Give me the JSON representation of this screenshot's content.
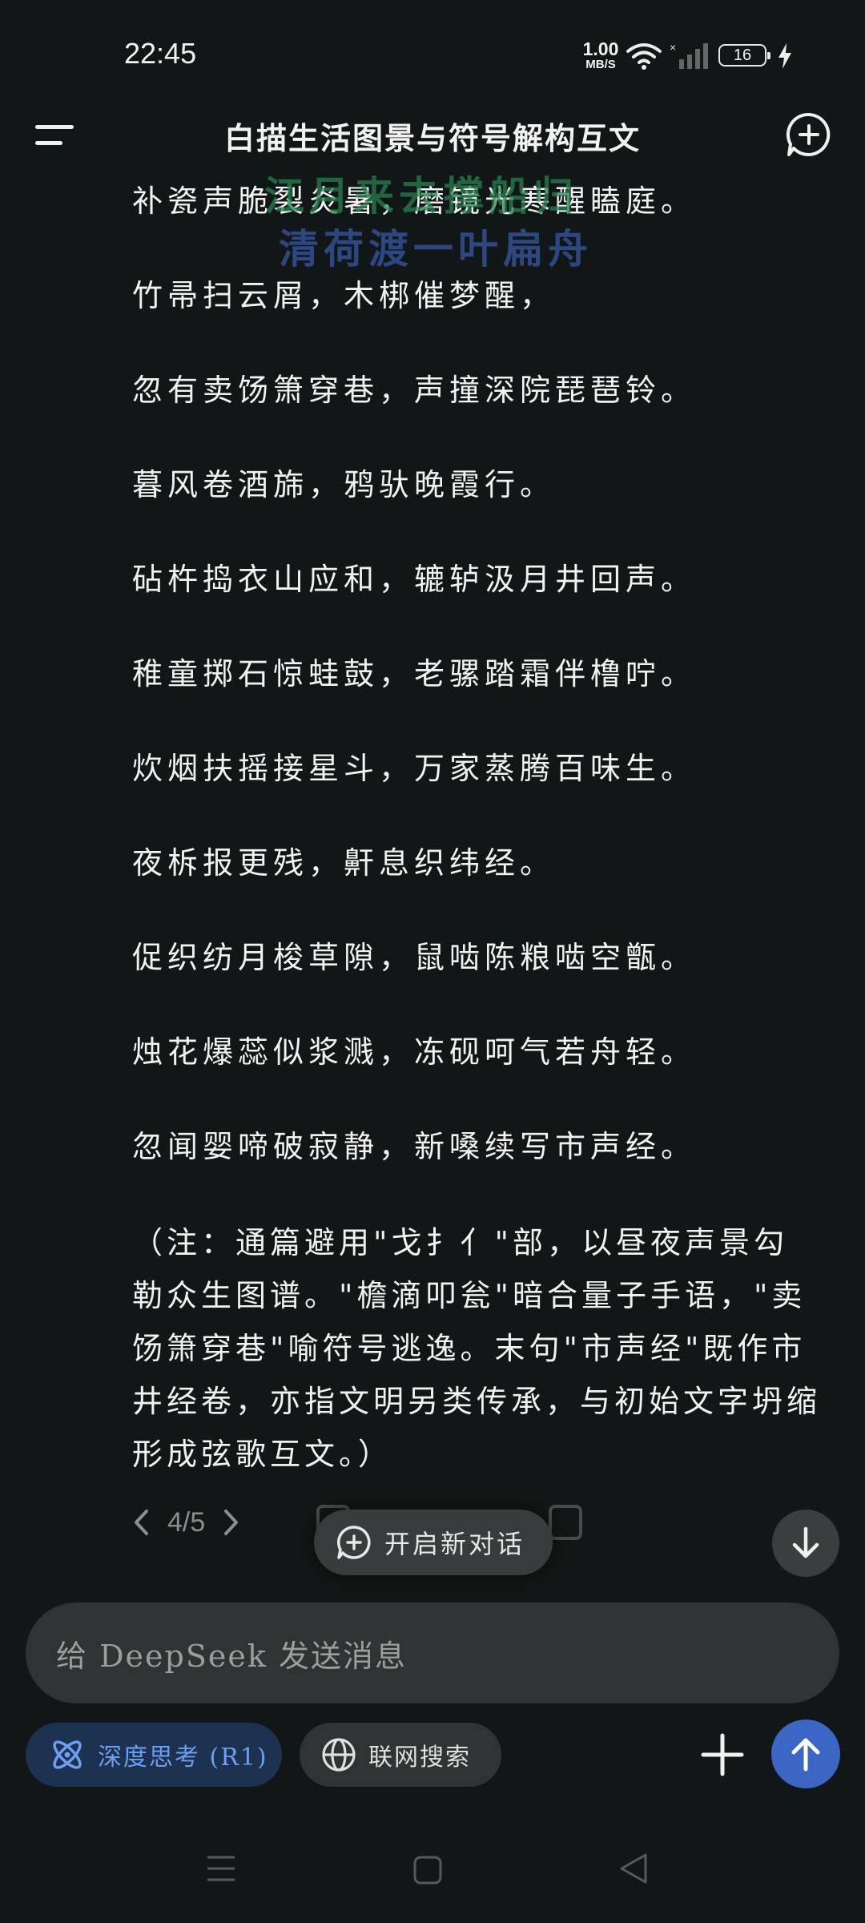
{
  "status_bar": {
    "time": "22:45",
    "net_speed_value": "1.00",
    "net_speed_unit": "MB/S",
    "battery": "16"
  },
  "header": {
    "title": "白描生活图景与符号解构互文"
  },
  "watermark": {
    "line1": "江月来去撑船归",
    "line2": "清荷渡一叶扁舟"
  },
  "poem_lines": [
    "补瓷声脆裂炎暑，磨镜光寒醒瞌庭。",
    "竹帚扫云屑，木梆催梦醒，",
    "忽有卖饧箫穿巷，声撞深院琵琶铃。",
    "暮风卷酒旆，鸦驮晚霞行。",
    "砧杵捣衣山应和，辘轳汲月井回声。",
    "稚童掷石惊蛙鼓，老骡踏霜伴橹咛。",
    "炊烟扶摇接星斗，万家蒸腾百味生。",
    "夜柝报更残，鼾息织纬经。",
    "促织纺月梭草隙，鼠啮陈粮啮空甑。",
    "烛花爆蕊似浆溅，冻砚呵气若舟轻。",
    "忽闻婴啼破寂静，新嗓续写市声经。"
  ],
  "note": "（注：通篇避用\"戈扌亻\"部，以昼夜声景勾勒众生图谱。\"檐滴叩瓮\"暗合量子手语，\"卖饧箫穿巷\"喻符号逃逸。末句\"市声经\"既作市井经卷，亦指文明另类传承，与初始文字坍缩形成弦歌互文。）",
  "pager": {
    "text": "4/5"
  },
  "new_conversation": {
    "label": "开启新对话"
  },
  "input": {
    "placeholder": "给 DeepSeek 发送消息"
  },
  "toolbar": {
    "deep_think_label": "深度思考 (R1)",
    "web_search_label": "联网搜索"
  },
  "colors": {
    "background": "#111716",
    "accent_blue": "#3b66c4",
    "deep_think_text": "#6c9ff0"
  }
}
